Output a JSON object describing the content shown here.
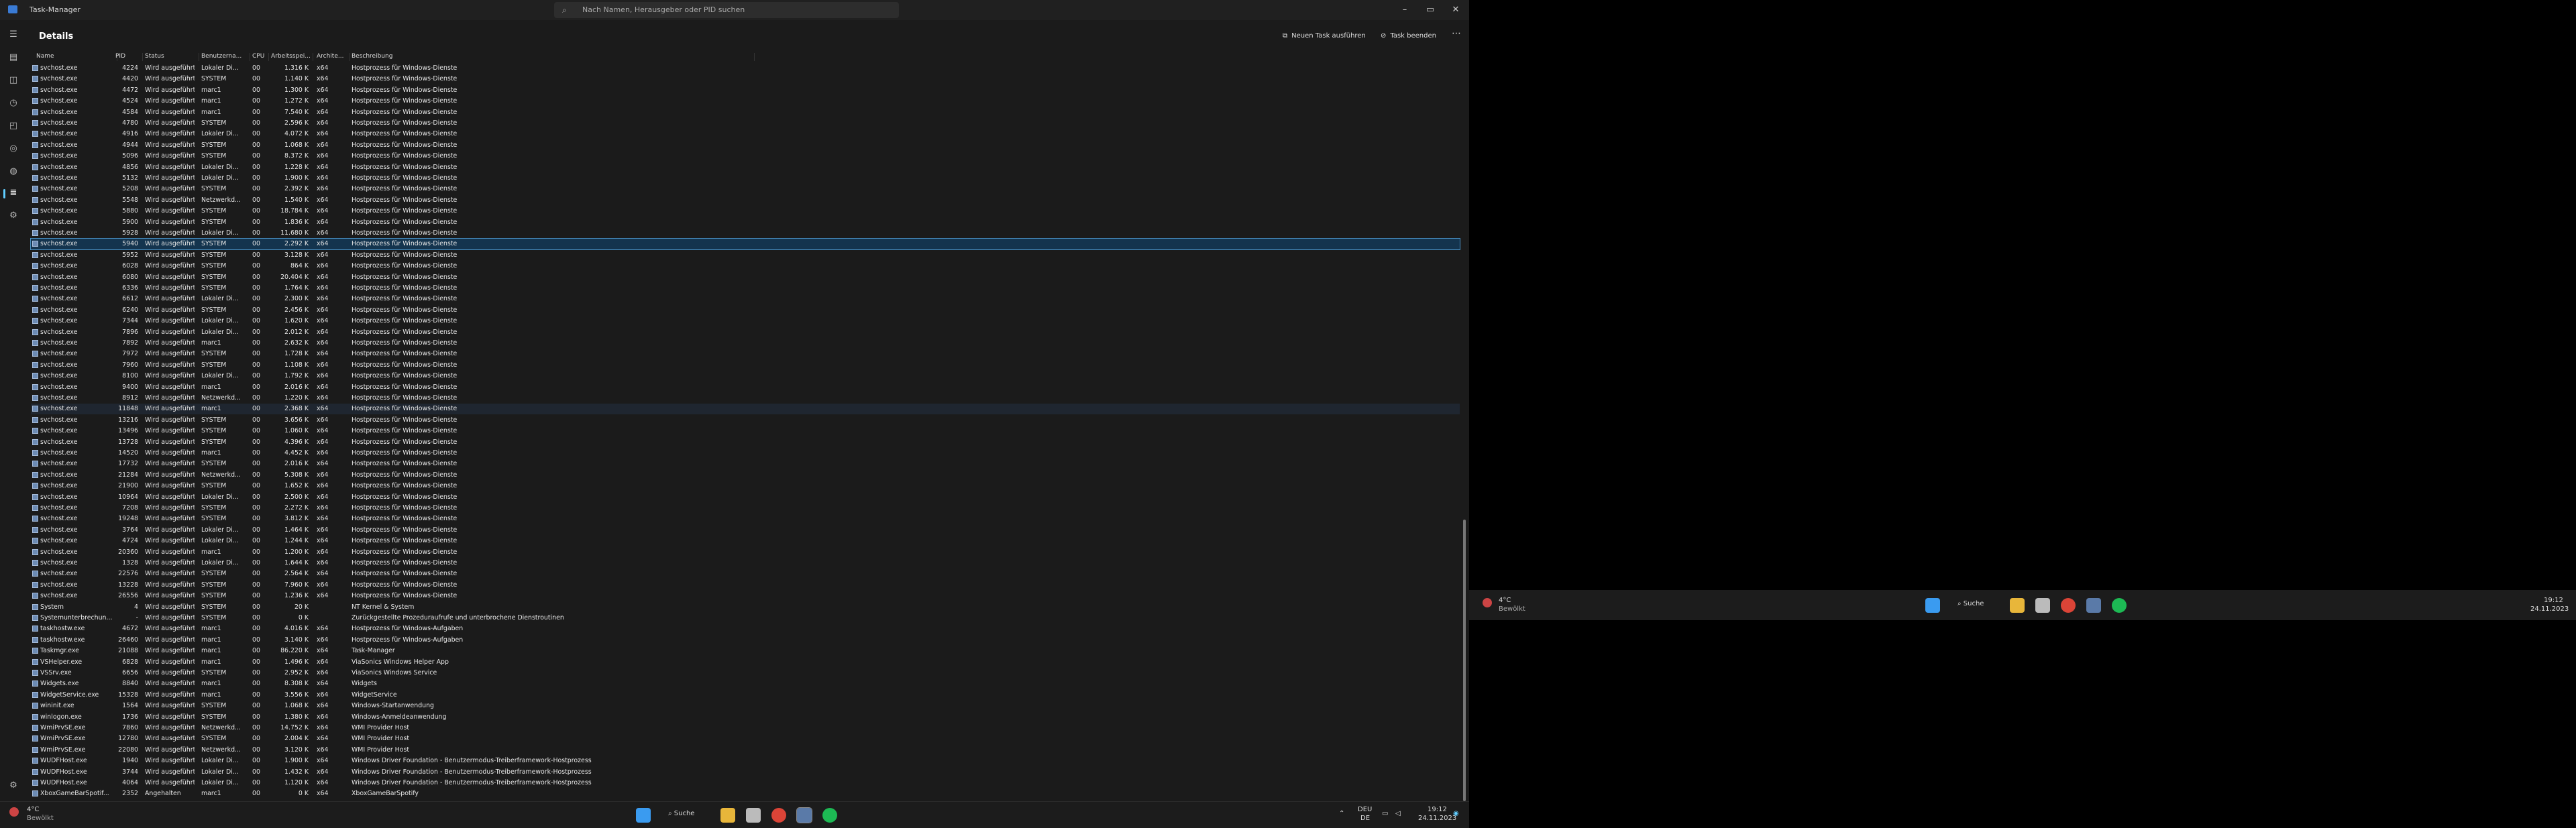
{
  "window": {
    "title": "Task-Manager"
  },
  "search": {
    "placeholder": "Nach Namen, Herausgeber oder PID suchen"
  },
  "header": {
    "title": "Details",
    "run_task": "Neuen Task ausführen",
    "end_task": "Task beenden",
    "more": "⋯"
  },
  "columns": [
    "Name",
    "PID",
    "Status",
    "Benutzerna...",
    "CPU",
    "Arbeitsspei...",
    "Archite...",
    "Beschreibung"
  ],
  "rows": [
    [
      "svchost.exe",
      "4224",
      "Wird ausgeführt",
      "Lokaler Di...",
      "00",
      "1.316 K",
      "x64",
      "Hostprozess für Windows-Dienste"
    ],
    [
      "svchost.exe",
      "4420",
      "Wird ausgeführt",
      "SYSTEM",
      "00",
      "1.140 K",
      "x64",
      "Hostprozess für Windows-Dienste"
    ],
    [
      "svchost.exe",
      "4472",
      "Wird ausgeführt",
      "marc1",
      "00",
      "1.300 K",
      "x64",
      "Hostprozess für Windows-Dienste"
    ],
    [
      "svchost.exe",
      "4524",
      "Wird ausgeführt",
      "marc1",
      "00",
      "1.272 K",
      "x64",
      "Hostprozess für Windows-Dienste"
    ],
    [
      "svchost.exe",
      "4584",
      "Wird ausgeführt",
      "marc1",
      "00",
      "7.540 K",
      "x64",
      "Hostprozess für Windows-Dienste"
    ],
    [
      "svchost.exe",
      "4780",
      "Wird ausgeführt",
      "SYSTEM",
      "00",
      "2.596 K",
      "x64",
      "Hostprozess für Windows-Dienste"
    ],
    [
      "svchost.exe",
      "4916",
      "Wird ausgeführt",
      "Lokaler Di...",
      "00",
      "4.072 K",
      "x64",
      "Hostprozess für Windows-Dienste"
    ],
    [
      "svchost.exe",
      "4944",
      "Wird ausgeführt",
      "SYSTEM",
      "00",
      "1.068 K",
      "x64",
      "Hostprozess für Windows-Dienste"
    ],
    [
      "svchost.exe",
      "5096",
      "Wird ausgeführt",
      "SYSTEM",
      "00",
      "8.372 K",
      "x64",
      "Hostprozess für Windows-Dienste"
    ],
    [
      "svchost.exe",
      "4856",
      "Wird ausgeführt",
      "Lokaler Di...",
      "00",
      "1.228 K",
      "x64",
      "Hostprozess für Windows-Dienste"
    ],
    [
      "svchost.exe",
      "5132",
      "Wird ausgeführt",
      "Lokaler Di...",
      "00",
      "1.900 K",
      "x64",
      "Hostprozess für Windows-Dienste"
    ],
    [
      "svchost.exe",
      "5208",
      "Wird ausgeführt",
      "SYSTEM",
      "00",
      "2.392 K",
      "x64",
      "Hostprozess für Windows-Dienste"
    ],
    [
      "svchost.exe",
      "5548",
      "Wird ausgeführt",
      "Netzwerkd...",
      "00",
      "1.540 K",
      "x64",
      "Hostprozess für Windows-Dienste"
    ],
    [
      "svchost.exe",
      "5880",
      "Wird ausgeführt",
      "SYSTEM",
      "00",
      "18.784 K",
      "x64",
      "Hostprozess für Windows-Dienste"
    ],
    [
      "svchost.exe",
      "5900",
      "Wird ausgeführt",
      "SYSTEM",
      "00",
      "1.836 K",
      "x64",
      "Hostprozess für Windows-Dienste"
    ],
    [
      "svchost.exe",
      "5928",
      "Wird ausgeführt",
      "Lokaler Di...",
      "00",
      "11.680 K",
      "x64",
      "Hostprozess für Windows-Dienste"
    ],
    [
      "svchost.exe",
      "5940",
      "Wird ausgeführt",
      "SYSTEM",
      "00",
      "2.292 K",
      "x64",
      "Hostprozess für Windows-Dienste"
    ],
    [
      "svchost.exe",
      "5952",
      "Wird ausgeführt",
      "SYSTEM",
      "00",
      "3.128 K",
      "x64",
      "Hostprozess für Windows-Dienste"
    ],
    [
      "svchost.exe",
      "6028",
      "Wird ausgeführt",
      "SYSTEM",
      "00",
      "864 K",
      "x64",
      "Hostprozess für Windows-Dienste"
    ],
    [
      "svchost.exe",
      "6080",
      "Wird ausgeführt",
      "SYSTEM",
      "00",
      "20.404 K",
      "x64",
      "Hostprozess für Windows-Dienste"
    ],
    [
      "svchost.exe",
      "6336",
      "Wird ausgeführt",
      "SYSTEM",
      "00",
      "1.764 K",
      "x64",
      "Hostprozess für Windows-Dienste"
    ],
    [
      "svchost.exe",
      "6612",
      "Wird ausgeführt",
      "Lokaler Di...",
      "00",
      "2.300 K",
      "x64",
      "Hostprozess für Windows-Dienste"
    ],
    [
      "svchost.exe",
      "6240",
      "Wird ausgeführt",
      "SYSTEM",
      "00",
      "2.456 K",
      "x64",
      "Hostprozess für Windows-Dienste"
    ],
    [
      "svchost.exe",
      "7344",
      "Wird ausgeführt",
      "Lokaler Di...",
      "00",
      "1.620 K",
      "x64",
      "Hostprozess für Windows-Dienste"
    ],
    [
      "svchost.exe",
      "7896",
      "Wird ausgeführt",
      "Lokaler Di...",
      "00",
      "2.012 K",
      "x64",
      "Hostprozess für Windows-Dienste"
    ],
    [
      "svchost.exe",
      "7892",
      "Wird ausgeführt",
      "marc1",
      "00",
      "2.632 K",
      "x64",
      "Hostprozess für Windows-Dienste"
    ],
    [
      "svchost.exe",
      "7972",
      "Wird ausgeführt",
      "SYSTEM",
      "00",
      "1.728 K",
      "x64",
      "Hostprozess für Windows-Dienste"
    ],
    [
      "svchost.exe",
      "7960",
      "Wird ausgeführt",
      "SYSTEM",
      "00",
      "1.108 K",
      "x64",
      "Hostprozess für Windows-Dienste"
    ],
    [
      "svchost.exe",
      "8100",
      "Wird ausgeführt",
      "Lokaler Di...",
      "00",
      "1.792 K",
      "x64",
      "Hostprozess für Windows-Dienste"
    ],
    [
      "svchost.exe",
      "9400",
      "Wird ausgeführt",
      "marc1",
      "00",
      "2.016 K",
      "x64",
      "Hostprozess für Windows-Dienste"
    ],
    [
      "svchost.exe",
      "8912",
      "Wird ausgeführt",
      "Netzwerkd...",
      "00",
      "1.220 K",
      "x64",
      "Hostprozess für Windows-Dienste"
    ],
    [
      "svchost.exe",
      "11848",
      "Wird ausgeführt",
      "marc1",
      "00",
      "2.368 K",
      "x64",
      "Hostprozess für Windows-Dienste"
    ],
    [
      "svchost.exe",
      "13216",
      "Wird ausgeführt",
      "SYSTEM",
      "00",
      "3.656 K",
      "x64",
      "Hostprozess für Windows-Dienste"
    ],
    [
      "svchost.exe",
      "13496",
      "Wird ausgeführt",
      "SYSTEM",
      "00",
      "1.060 K",
      "x64",
      "Hostprozess für Windows-Dienste"
    ],
    [
      "svchost.exe",
      "13728",
      "Wird ausgeführt",
      "SYSTEM",
      "00",
      "4.396 K",
      "x64",
      "Hostprozess für Windows-Dienste"
    ],
    [
      "svchost.exe",
      "14520",
      "Wird ausgeführt",
      "marc1",
      "00",
      "4.452 K",
      "x64",
      "Hostprozess für Windows-Dienste"
    ],
    [
      "svchost.exe",
      "17732",
      "Wird ausgeführt",
      "SYSTEM",
      "00",
      "2.016 K",
      "x64",
      "Hostprozess für Windows-Dienste"
    ],
    [
      "svchost.exe",
      "21284",
      "Wird ausgeführt",
      "Netzwerkd...",
      "00",
      "5.308 K",
      "x64",
      "Hostprozess für Windows-Dienste"
    ],
    [
      "svchost.exe",
      "21900",
      "Wird ausgeführt",
      "SYSTEM",
      "00",
      "1.652 K",
      "x64",
      "Hostprozess für Windows-Dienste"
    ],
    [
      "svchost.exe",
      "10964",
      "Wird ausgeführt",
      "Lokaler Di...",
      "00",
      "2.500 K",
      "x64",
      "Hostprozess für Windows-Dienste"
    ],
    [
      "svchost.exe",
      "7208",
      "Wird ausgeführt",
      "SYSTEM",
      "00",
      "2.272 K",
      "x64",
      "Hostprozess für Windows-Dienste"
    ],
    [
      "svchost.exe",
      "19248",
      "Wird ausgeführt",
      "SYSTEM",
      "00",
      "3.812 K",
      "x64",
      "Hostprozess für Windows-Dienste"
    ],
    [
      "svchost.exe",
      "3764",
      "Wird ausgeführt",
      "Lokaler Di...",
      "00",
      "1.464 K",
      "x64",
      "Hostprozess für Windows-Dienste"
    ],
    [
      "svchost.exe",
      "4724",
      "Wird ausgeführt",
      "Lokaler Di...",
      "00",
      "1.244 K",
      "x64",
      "Hostprozess für Windows-Dienste"
    ],
    [
      "svchost.exe",
      "20360",
      "Wird ausgeführt",
      "marc1",
      "00",
      "1.200 K",
      "x64",
      "Hostprozess für Windows-Dienste"
    ],
    [
      "svchost.exe",
      "1328",
      "Wird ausgeführt",
      "Lokaler Di...",
      "00",
      "1.644 K",
      "x64",
      "Hostprozess für Windows-Dienste"
    ],
    [
      "svchost.exe",
      "22576",
      "Wird ausgeführt",
      "SYSTEM",
      "00",
      "2.564 K",
      "x64",
      "Hostprozess für Windows-Dienste"
    ],
    [
      "svchost.exe",
      "13228",
      "Wird ausgeführt",
      "SYSTEM",
      "00",
      "7.960 K",
      "x64",
      "Hostprozess für Windows-Dienste"
    ],
    [
      "svchost.exe",
      "26556",
      "Wird ausgeführt",
      "SYSTEM",
      "00",
      "1.236 K",
      "x64",
      "Hostprozess für Windows-Dienste"
    ],
    [
      "System",
      "4",
      "Wird ausgeführt",
      "SYSTEM",
      "00",
      "20 K",
      "",
      "NT Kernel & System"
    ],
    [
      "Systemunterbrechun...",
      "-",
      "Wird ausgeführt",
      "SYSTEM",
      "00",
      "0 K",
      "",
      "Zurückgestellte Prozeduraufrufe und unterbrochene Dienstroutinen"
    ],
    [
      "taskhostw.exe",
      "4672",
      "Wird ausgeführt",
      "marc1",
      "00",
      "4.016 K",
      "x64",
      "Hostprozess für Windows-Aufgaben"
    ],
    [
      "taskhostw.exe",
      "26460",
      "Wird ausgeführt",
      "marc1",
      "00",
      "3.140 K",
      "x64",
      "Hostprozess für Windows-Aufgaben"
    ],
    [
      "Taskmgr.exe",
      "21088",
      "Wird ausgeführt",
      "marc1",
      "00",
      "86.220 K",
      "x64",
      "Task-Manager"
    ],
    [
      "VSHelper.exe",
      "6828",
      "Wird ausgeführt",
      "marc1",
      "00",
      "1.496 K",
      "x64",
      "ViaSonics Windows Helper App"
    ],
    [
      "VSSrv.exe",
      "6656",
      "Wird ausgeführt",
      "SYSTEM",
      "00",
      "2.952 K",
      "x64",
      "ViaSonics Windows Service"
    ],
    [
      "Widgets.exe",
      "8840",
      "Wird ausgeführt",
      "marc1",
      "00",
      "8.308 K",
      "x64",
      "Widgets"
    ],
    [
      "WidgetService.exe",
      "15328",
      "Wird ausgeführt",
      "marc1",
      "00",
      "3.556 K",
      "x64",
      "WidgetService"
    ],
    [
      "wininit.exe",
      "1564",
      "Wird ausgeführt",
      "SYSTEM",
      "00",
      "1.068 K",
      "x64",
      "Windows-Startanwendung"
    ],
    [
      "winlogon.exe",
      "1736",
      "Wird ausgeführt",
      "SYSTEM",
      "00",
      "1.380 K",
      "x64",
      "Windows-Anmeldeanwendung"
    ],
    [
      "WmiPrvSE.exe",
      "7860",
      "Wird ausgeführt",
      "Netzwerkd...",
      "00",
      "14.752 K",
      "x64",
      "WMI Provider Host"
    ],
    [
      "WmiPrvSE.exe",
      "12780",
      "Wird ausgeführt",
      "SYSTEM",
      "00",
      "2.004 K",
      "x64",
      "WMI Provider Host"
    ],
    [
      "WmiPrvSE.exe",
      "22080",
      "Wird ausgeführt",
      "Netzwerkd...",
      "00",
      "3.120 K",
      "x64",
      "WMI Provider Host"
    ],
    [
      "WUDFHost.exe",
      "1940",
      "Wird ausgeführt",
      "Lokaler Di...",
      "00",
      "1.900 K",
      "x64",
      "Windows Driver Foundation - Benutzermodus-Treiberframework-Hostprozess"
    ],
    [
      "WUDFHost.exe",
      "3744",
      "Wird ausgeführt",
      "Lokaler Di...",
      "00",
      "1.432 K",
      "x64",
      "Windows Driver Foundation - Benutzermodus-Treiberframework-Hostprozess"
    ],
    [
      "WUDFHost.exe",
      "4064",
      "Wird ausgeführt",
      "Lokaler Di...",
      "00",
      "1.120 K",
      "x64",
      "Windows Driver Foundation - Benutzermodus-Treiberframework-Hostprozess"
    ],
    [
      "XboxGameBarSpotif...",
      "2352",
      "Angehalten",
      "marc1",
      "00",
      "0 K",
      "x64",
      "XboxGameBarSpotify"
    ]
  ],
  "selected_row": 16,
  "hover_row": 31,
  "taskbar": {
    "weather_temp": "4°C",
    "weather_desc": "Bewölkt",
    "search_label": "Suche",
    "lang1": "DEU",
    "lang2": "DE",
    "time": "19:12",
    "date": "24.11.2023"
  },
  "taskbar2": {
    "weather_temp": "4°C",
    "weather_desc": "Bewölkt",
    "search_label": "Suche",
    "time": "19:12",
    "date": "24.11.2023"
  },
  "colors": {
    "accent": "#60cdff",
    "selected": "#14344e"
  }
}
